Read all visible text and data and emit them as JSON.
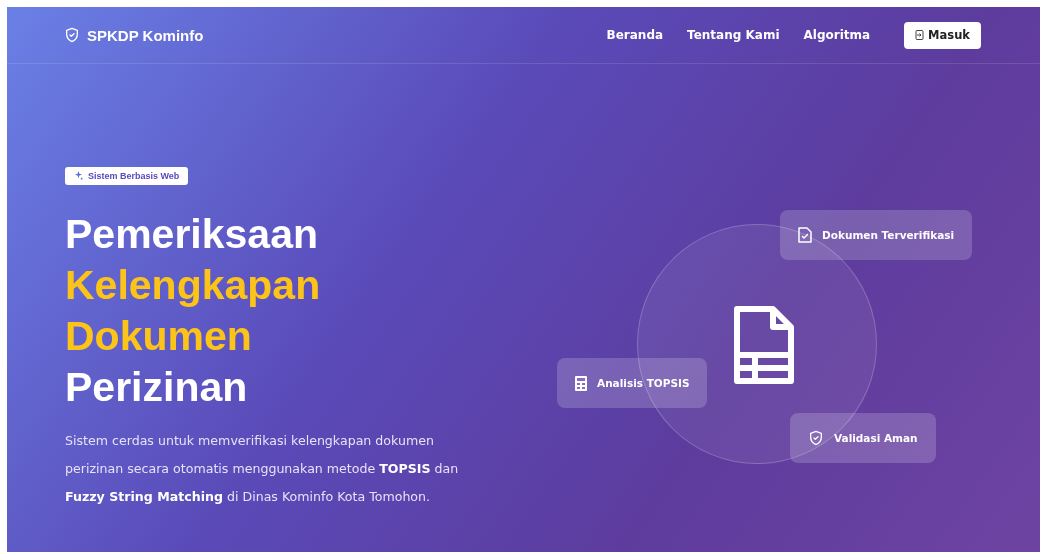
{
  "navbar": {
    "brand": "SPKDP Kominfo",
    "links": [
      {
        "label": "Beranda"
      },
      {
        "label": "Tentang Kami"
      },
      {
        "label": "Algoritma"
      }
    ],
    "login_button": "Masuk"
  },
  "hero": {
    "badge": "Sistem Berbasis Web",
    "headline": [
      {
        "text": "Pemeriksaan",
        "highlight": false
      },
      {
        "text": "Kelengkapan",
        "highlight": true
      },
      {
        "text": "Dokumen",
        "highlight": true
      },
      {
        "text": "Perizinan",
        "highlight": false
      }
    ],
    "description": "Sistem cerdas untuk memverifikasi kelengkapan dokumen perizinan secara otomatis menggunakan metode **TOPSIS** dan **Fuzzy String Matching** di Dinas Kominfo Kota Tomohon.",
    "feature_cards": [
      {
        "kind": "verified",
        "label": "Dokumen Terverifikasi"
      },
      {
        "kind": "analysis",
        "label": "Analisis TOPSIS"
      },
      {
        "kind": "secure",
        "label": "Validasi Aman"
      }
    ]
  }
}
